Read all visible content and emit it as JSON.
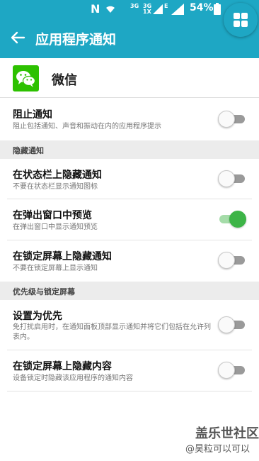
{
  "status_bar": {
    "n_icon": "N",
    "signal1": "3G",
    "signal1_sub": "1X",
    "signal2": "3G",
    "network": "E",
    "battery": "54%"
  },
  "header": {
    "title": "应用程序通知",
    "back_icon": "arrow-back-icon",
    "fab_icon": "grid-icon"
  },
  "app": {
    "name": "微信",
    "icon": "wechat-icon"
  },
  "settings": {
    "block": {
      "title": "阻止通知",
      "subtitle": "阻止包括通知、声音和振动在内的应用程序提示",
      "enabled": false
    },
    "section_hide": "隐藏通知",
    "hide_status_bar": {
      "title": "在状态栏上隐藏通知",
      "subtitle": "不要在状态栏显示通知图标",
      "enabled": false
    },
    "popup_preview": {
      "title": "在弹出窗口中预览",
      "subtitle": "在弹出窗口中显示通知预览",
      "enabled": true
    },
    "hide_lock_screen": {
      "title": "在锁定屏幕上隐藏通知",
      "subtitle": "不要在锁定屏幕上显示通知",
      "enabled": false
    },
    "section_priority": "优先级与锁定屏幕",
    "set_priority": {
      "title": "设置为优先",
      "subtitle": "免打扰启用时，在通知面板顶部显示通知并将它们包括在允许列表内。",
      "enabled": false
    },
    "hide_content": {
      "title": "在锁定屏幕上隐藏内容",
      "subtitle": "设备锁定时隐藏该应用程序的通知内容",
      "enabled": false
    }
  },
  "watermark": {
    "line1": "盖乐世社区",
    "line2": "@昊粒可以可以"
  },
  "colors": {
    "accent": "#1ea7c4",
    "toggle_on": "#3db447",
    "wechat": "#2dc100"
  }
}
